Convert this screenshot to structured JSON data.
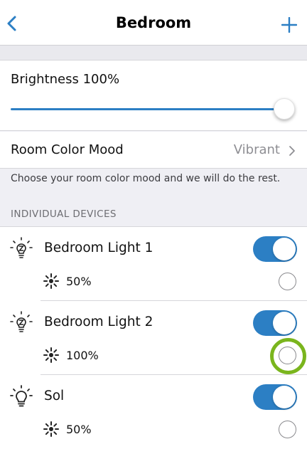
{
  "header": {
    "title": "Bedroom",
    "back_icon": "chevron-left-icon",
    "add_icon": "plus-icon",
    "accent_color": "#2c7fc4"
  },
  "brightness": {
    "label": "Brightness 100%",
    "value_fraction": 1.0
  },
  "color_mood": {
    "label": "Room Color Mood",
    "value": "Vibrant"
  },
  "hint_text": "Choose your room color mood and we will do the rest.",
  "section_header": "INDIVIDUAL DEVICES",
  "devices": [
    {
      "name": "Bedroom Light 1",
      "icon": "bulb-z-icon",
      "on": true,
      "brightness": "50%",
      "selected": false
    },
    {
      "name": "Bedroom Light 2",
      "icon": "bulb-z-icon",
      "on": true,
      "brightness": "100%",
      "selected": false,
      "highlighted": true,
      "highlight_color": "#7ab51d"
    },
    {
      "name": "Sol",
      "icon": "bulb-icon",
      "on": true,
      "brightness": "50%",
      "selected": false
    }
  ]
}
